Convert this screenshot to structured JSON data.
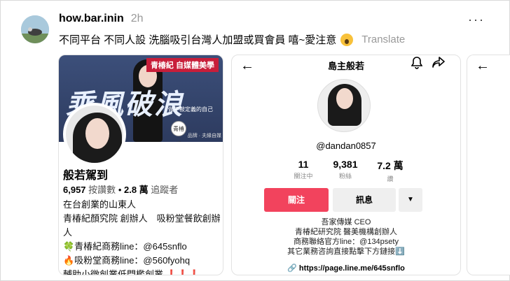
{
  "post": {
    "username": "how.bar.inin",
    "time": "2h",
    "more_label": "···",
    "caption": "不同平台 不同人設 洗腦吸引台灣人加盟或買會員 嘻~愛注意",
    "translate_label": "Translate"
  },
  "card1": {
    "banner_tag": "青椿紀 自媒體美學",
    "banner_text": "乘風破浪",
    "banner_sub": "做不被定義的自己",
    "banner_logo": "青椿紀",
    "banner_foot": "品牌 · 夫緣自媒",
    "name": "般若駕到",
    "likes_count": "6,957",
    "likes_label": "按讚數",
    "followers_count": "2.8 萬",
    "followers_label": "追蹤者",
    "bio_lines": [
      "在台創業的山東人",
      "青椿紀顏究院 創辦人　吸粉堂餐飲創辦人",
      "🍀青椿紀商務line：@645snflo",
      "🔥吸粉堂商務line：@560fyohq",
      "輔助小微創業低門檻創業 ❗❗❗"
    ]
  },
  "card2": {
    "back_icon": "←",
    "title": "島主般若",
    "handle": "@dandan0857",
    "stats": [
      {
        "num": "11",
        "label": "關注中"
      },
      {
        "num": "9,381",
        "label": "粉絲"
      },
      {
        "num": "7.2 萬",
        "label": "讚"
      }
    ],
    "follow_label": "關注",
    "message_label": "訊息",
    "more_label": "▼",
    "bio_lines": [
      "吾家傳媒 CEO",
      "青椿紀研究院 醫美機構創辦人",
      "商務聯絡官方line：@134psety",
      "其它業務咨詢直接點擊下方鏈接⬇️"
    ],
    "link": "https://page.line.me/645snflo"
  },
  "card3": {
    "back_icon": "←"
  }
}
